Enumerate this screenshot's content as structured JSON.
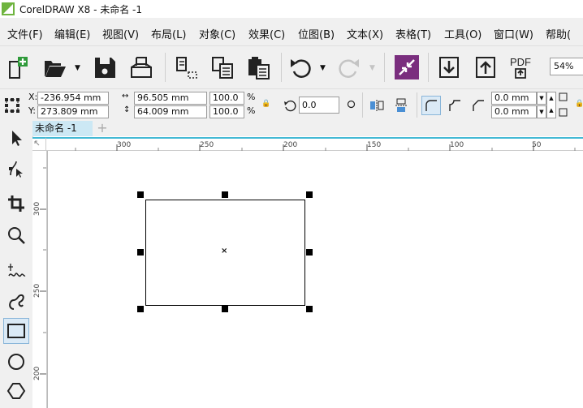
{
  "window": {
    "title": "CorelDRAW X8 - 未命名 -1"
  },
  "menu": [
    "文件(F)",
    "编辑(E)",
    "视图(V)",
    "布局(L)",
    "对象(C)",
    "效果(C)",
    "位图(B)",
    "文本(X)",
    "表格(T)",
    "工具(O)",
    "窗口(W)",
    "帮助("
  ],
  "toolbar": {
    "zoom": "54%",
    "pdf_label": "PDF"
  },
  "property_bar": {
    "x_label": "X:",
    "x_value": "-236.954 mm",
    "y_label": "Y:",
    "y_value": "273.809 mm",
    "width_value": "96.505 mm",
    "height_value": "64.009 mm",
    "scale_x": "100.0",
    "scale_y": "100.0",
    "percent": "%",
    "rotation": "0.0",
    "corner_1": "0.0 mm",
    "corner_2": "0.0 mm"
  },
  "document": {
    "tab_label": "未命名 -1",
    "new_tab": "+"
  },
  "rulers": {
    "horizontal": [
      "300",
      "250",
      "200",
      "150",
      "100",
      "50"
    ],
    "vertical": [
      "300",
      "250",
      "200"
    ]
  },
  "colors": {
    "accent": "#43b9d4",
    "tab_active": "#cce8f4",
    "toolbar_bg": "#f0f0f0",
    "logo": "#6fb43f"
  }
}
